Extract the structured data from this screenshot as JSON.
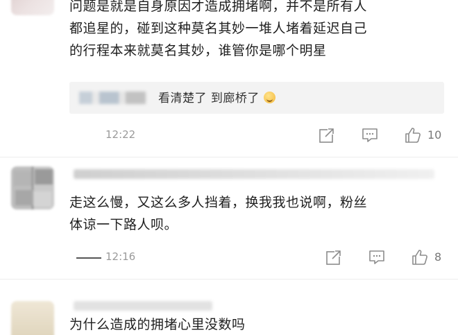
{
  "comments": [
    {
      "text_line1": "问题是就是自身原因才造成拥堵啊，并不是所有人",
      "text_line2": "都追星的，碰到这种莫名其妙一堆人堵着延迟自己",
      "text_line3": "的行程本来就莫名其妙，谁管你是哪个明星",
      "reply": {
        "text": "看清楚了 到廊桥了"
      },
      "time": "12:22",
      "likes": "10"
    },
    {
      "text_line1": "走这么慢，又这么多人挡着，换我我也说啊，粉丝",
      "text_line2": "体谅一下路人呗。",
      "time": "12:16",
      "likes": "8"
    },
    {
      "text_line1": "为什么造成的拥堵心里没数吗"
    }
  ],
  "icons": {
    "share": "share-icon",
    "comment": "comment-icon",
    "like": "thumbs-up-icon",
    "reply_emoji": "laughing-emoji-icon"
  },
  "colors": {
    "text": "#1e1e1e",
    "meta": "#9a9a9a",
    "reply_bg": "#f3f3f3"
  }
}
